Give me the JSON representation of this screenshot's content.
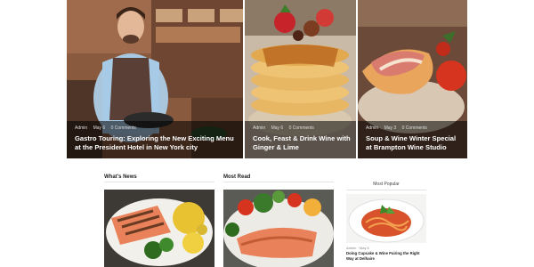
{
  "hero_posts": [
    {
      "meta": [
        "Admin",
        "May 6",
        "0 Comments"
      ],
      "title": "Gastro Touring: Exploring the New Exciting Menu at the President Hotel in New York city"
    },
    {
      "meta": [
        "Admin",
        "May 6",
        "0 Comments"
      ],
      "title": "Cook, Feast & Drink Wine with Ginger & Lime"
    },
    {
      "meta": [
        "Admin",
        "May 3",
        "0 Comments"
      ],
      "title": "Soup & Wine Winter Special at Brampton Wine Studio"
    }
  ],
  "sections": {
    "whats_news": "What's News",
    "most_read": "Most Read"
  },
  "sidebar": {
    "heading": "Most Popular",
    "meta": "Admin · May 6",
    "title": "Doing Cupcake & Wine Pairing the Right Way at Delhaire"
  },
  "colors": {
    "overlay": "#000000",
    "salmon": "#e9825a",
    "pancake": "#e7b35f",
    "tomato": "#d7341f"
  }
}
